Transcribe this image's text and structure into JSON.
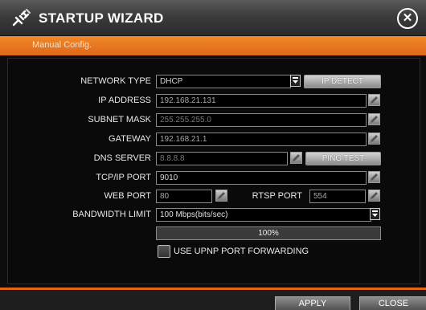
{
  "title": "STARTUP WIZARD",
  "subtitle": "Manual Config.",
  "colors": {
    "accent": "#e0661a",
    "title_bg": "#3c3c3c",
    "field_bg": "#000000"
  },
  "icons": {
    "title": "network-plug-icon",
    "close": "close-icon",
    "edit": "pencil-icon",
    "dropdown": "dropdown-arrow-icon"
  },
  "form": {
    "network_type": {
      "label": "NETWORK TYPE",
      "value": "DHCP"
    },
    "ip_detect_label": "IP DETECT",
    "ip_address": {
      "label": "IP ADDRESS",
      "value": "192.168.21.131"
    },
    "subnet_mask": {
      "label": "SUBNET MASK",
      "value": "255.255.255.0"
    },
    "gateway": {
      "label": "GATEWAY",
      "value": "192.168.21.1"
    },
    "dns_server": {
      "label": "DNS SERVER",
      "value": "8.8.8.8"
    },
    "ping_test_label": "PING TEST",
    "tcpip_port": {
      "label": "TCP/IP PORT",
      "value": "9010"
    },
    "web_port": {
      "label": "WEB PORT",
      "value": "80"
    },
    "rtsp_port": {
      "label": "RTSP PORT",
      "value": "554"
    },
    "bandwidth_limit": {
      "label": "BANDWIDTH LIMIT",
      "value": "100 Mbps(bits/sec)"
    },
    "progress": {
      "text": "100%",
      "fraction": 1.0
    },
    "upnp": {
      "label": "USE UPNP PORT FORWARDING",
      "checked": false
    }
  },
  "footer": {
    "apply_label": "APPLY",
    "close_label": "CLOSE"
  }
}
